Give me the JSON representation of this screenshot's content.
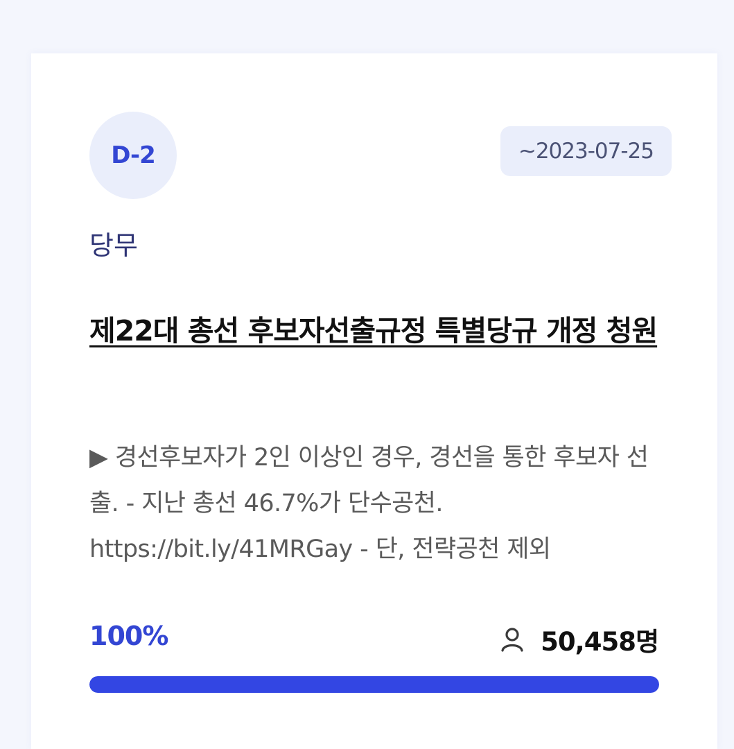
{
  "petition": {
    "dday": "D-2",
    "deadline": "~2023-07-25",
    "category": "당무",
    "title": "제22대 총선 후보자선출규정 특별당규 개정 청원",
    "summary": "▶ 경선후보자가 2인 이상인 경우, 경선을 통한 후보자 선출. - 지난 총선 46.7%가 단수공천. https://bit.ly/41MRGay - 단, 전략공천 제외",
    "percent_label": "100%",
    "progress": 1.0,
    "signer_count": "50,458명",
    "person_icon": "person-icon"
  },
  "colors": {
    "accent": "#3346d3",
    "badge_bg": "#eaeefb",
    "progress_fill": "#3346e3"
  }
}
